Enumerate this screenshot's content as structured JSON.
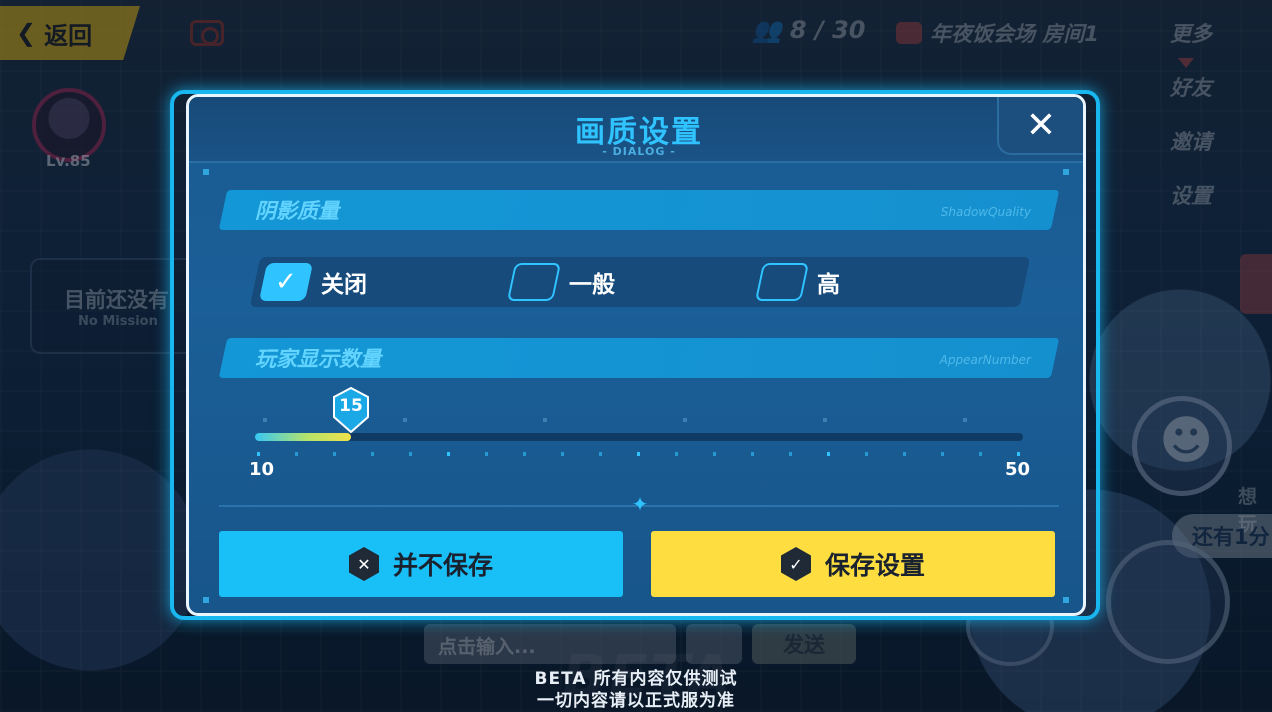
{
  "topbar": {
    "back_label": "返回",
    "player_count": "8 / 30",
    "room_name": "年夜饭会场 房间1",
    "menu": [
      "更多",
      "好友",
      "邀请",
      "设置"
    ]
  },
  "profile": {
    "level": "Lv.85"
  },
  "mission": {
    "title": "目前还没有",
    "subtitle": "No Mission"
  },
  "right_panel": {
    "want_play": "想玩",
    "remaining": "还有1分"
  },
  "chat": {
    "input_placeholder": "点击输入...",
    "send_label": "发送"
  },
  "beta": {
    "line1": "BETA 所有内容仅供测试",
    "line2": "一切内容请以正式服为准",
    "watermark": "BETA"
  },
  "dialog": {
    "title": "画质设置",
    "subtitle": "- DIALOG -",
    "close_symbol": "✕",
    "shadow": {
      "label": "阴影质量",
      "tag": "ShadowQuality",
      "options": [
        {
          "label": "关闭",
          "checked": true
        },
        {
          "label": "一般",
          "checked": false
        },
        {
          "label": "高",
          "checked": false
        }
      ]
    },
    "players": {
      "label": "玩家显示数量",
      "tag": "AppearNumber",
      "value": "15",
      "min": "10",
      "max": "50",
      "current": 15,
      "range": [
        10,
        50
      ]
    },
    "buttons": {
      "cancel": "并不保存",
      "save": "保存设置"
    }
  },
  "colors": {
    "accent": "#2fc3ff",
    "cancel_button": "#19c0f7",
    "save_button": "#fddd40",
    "dialog_bg": "#1a5b92"
  }
}
